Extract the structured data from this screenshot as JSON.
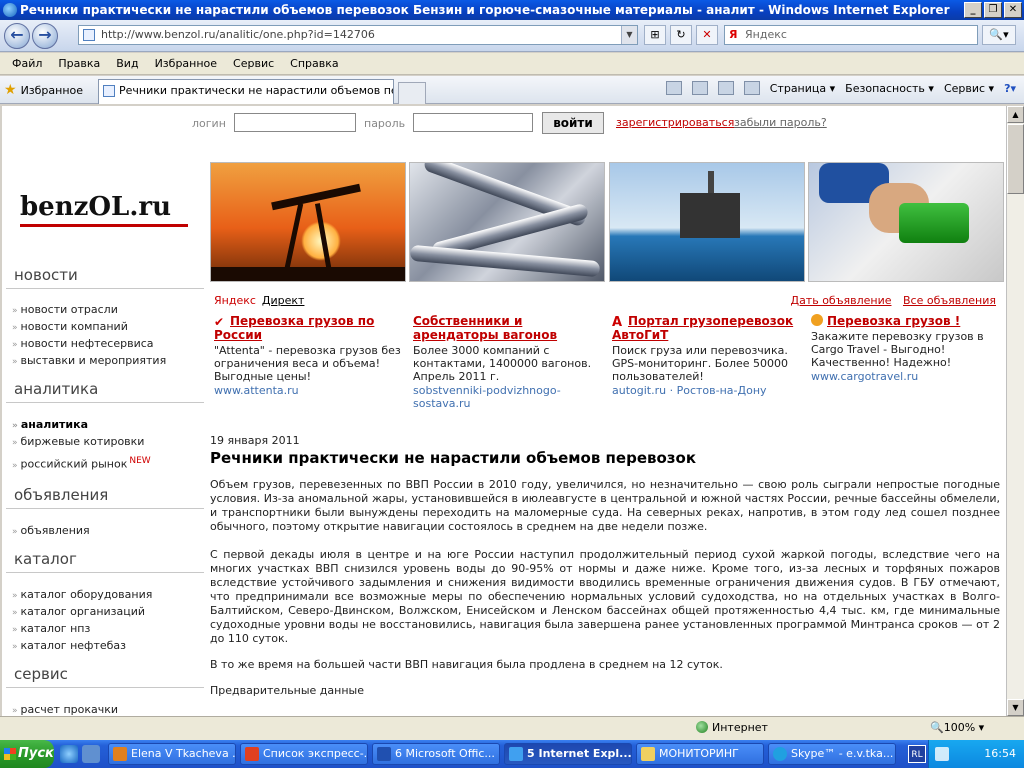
{
  "window": {
    "title": "Речники практически не нарастили объемов перевозок Бензин и горюче-смазочные материалы - аналит - Windows Internet Explorer"
  },
  "address": {
    "url": "http://www.benzol.ru/analitic/one.php?id=142706",
    "search_placeholder": "Яндекс"
  },
  "menu": [
    "Файл",
    "Правка",
    "Вид",
    "Избранное",
    "Сервис",
    "Справка"
  ],
  "favorites": {
    "label": "Избранное",
    "tab_title": "Речники практически не нарастили объемов перев..."
  },
  "commandbar": {
    "page": "Страница",
    "safety": "Безопасность",
    "tools": "Сервис"
  },
  "login": {
    "login_label": "логин",
    "password_label": "пароль",
    "submit": "войти",
    "register": "зарегистрироваться",
    "forgot": "забыли пароль?"
  },
  "sidebar": {
    "logo": "benzOL.ru",
    "sections": [
      {
        "title": "новости",
        "items": [
          "новости отрасли",
          "новости компаний",
          "новости нефтесервиса",
          "выставки и мероприятия"
        ]
      },
      {
        "title": "аналитика",
        "items": [
          "аналитика",
          "биржевые котировки",
          "российский рынок"
        ],
        "badge": "NEW"
      },
      {
        "title": "объявления",
        "items": [
          "объявления"
        ]
      },
      {
        "title": "каталог",
        "items": [
          "каталог оборудования",
          "каталог организаций",
          "каталог нпз",
          "каталог нефтебаз"
        ]
      },
      {
        "title": "сервис",
        "items": [
          "расчет прокачки"
        ]
      }
    ]
  },
  "direct": {
    "yandex": "Яндекс",
    "direct": "Директ",
    "post_ad": "Дать объявление",
    "all_ads": "Все объявления",
    "ads": [
      {
        "title": "Перевозка грузов по России",
        "text": "\"Attenta\" - перевозка грузов без ограничения веса и объема! Выгодные цены!",
        "url": "www.attenta.ru"
      },
      {
        "title": "Собственники и арендаторы вагонов",
        "text": "Более 3000 компаний с контактами, 1400000 вагонов. Апрель 2011 г.",
        "url": "sobstvenniki-podvizhnogo-sostava.ru"
      },
      {
        "title": "Портал грузоперевозок АвтоГиТ",
        "text": "Поиск груза или перевозчика. GPS-мониторинг. Более 50000 пользователей!",
        "url": "autogit.ru · Ростов-на-Дону"
      },
      {
        "title": "Перевозка грузов !",
        "text": "Закажите перевозку грузов в Cargo Travel - Выгодно! Качественно! Надежно!",
        "url": "www.cargotravel.ru"
      }
    ]
  },
  "article": {
    "date": "19 января 2011",
    "title": "Речники практически не нарастили объемов перевозок",
    "paragraphs": [
      "Объем грузов, перевезенных по ВВП России в 2010 году, увеличился, но незначительно — свою роль сыграли непростые погодные условия. Из-за аномальной жары, установившейся в июлеавгусте в центральной и южной частях России, речные бассейны обмелели, и транспортники были вынуждены переходить на маломерные суда. На северных реках, напротив, в этом году лед сошел позднее обычного, поэтому открытие навигации состоялось в среднем на две недели позже.",
      "С первой декады июля в центре и на юге России наступил продолжительный период сухой жаркой погоды, вследствие чего на многих участках ВВП снизился уровень воды до 90-95% от нормы и даже ниже. Кроме того, из-за лесных и торфяных пожаров вследствие устойчивого задымления и снижения видимости вводились временные ограничения движения судов. В ГБУ отмечают, что предпринимали все возможные меры по обеспечению нормальных условий судоходства, но на отдельных участках в Волго-Балтийском, Северо-Двинском, Волжском, Енисейском и Ленском бассейнах общей протяженностью 4,4 тыс. км, где минимальные судоходные уровни воды не восстановились, навигация была завершена ранее установленных программой Минтранса сроков — от 2 до 110 суток.",
      "В то же время на большей части ВВП навигация была продлена в среднем на 12 суток.",
      "Предварительные данные"
    ]
  },
  "status": {
    "zone": "Интернет",
    "zoom": "100%"
  },
  "taskbar": {
    "start": "Пуск",
    "tasks": [
      "Elena V Tkacheva ...",
      "Список экспресс-...",
      "6 Microsoft Offic...",
      "5 Internet Expl...",
      "МОНИТОРИНГ",
      "Skype™ - e.v.tka..."
    ],
    "lang": "RL",
    "clock": "16:54"
  }
}
